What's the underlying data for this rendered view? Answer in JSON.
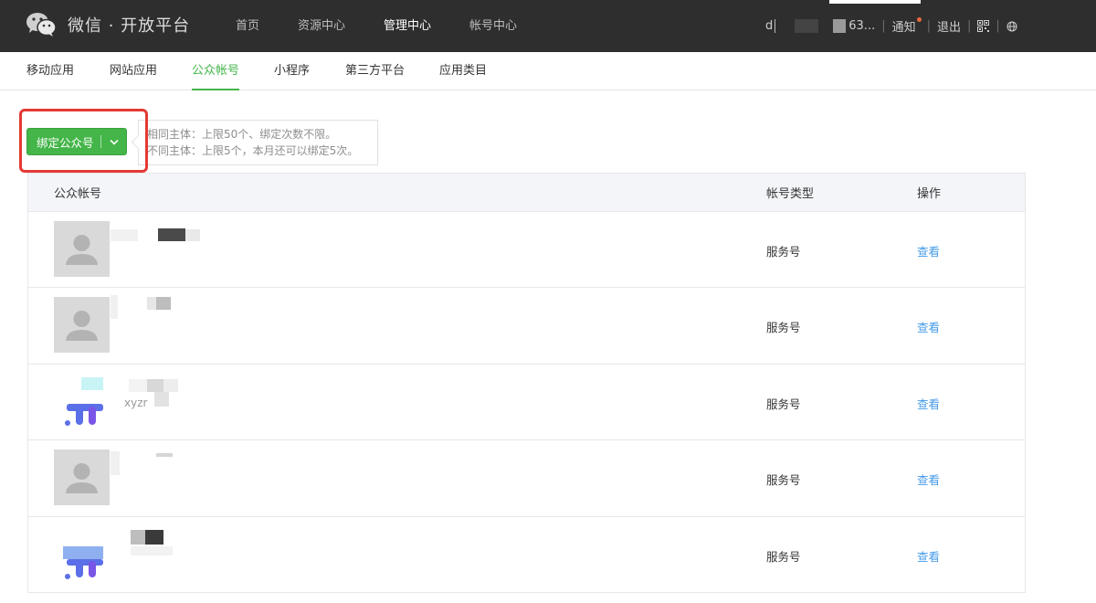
{
  "brand": {
    "name": "微信 · 开放平台"
  },
  "top_nav": [
    {
      "label": "首页",
      "active": false
    },
    {
      "label": "资源中心",
      "active": false
    },
    {
      "label": "管理中心",
      "active": true
    },
    {
      "label": "帐号中心",
      "active": false
    }
  ],
  "user": {
    "name_prefix": "d",
    "name_suffix": "63...",
    "notice_label": "通知",
    "logout_label": "退出",
    "qr_icon": "qrcode-icon",
    "globe_icon": "globe-icon"
  },
  "sub_tabs": [
    {
      "label": "移动应用",
      "active": false
    },
    {
      "label": "网站应用",
      "active": false
    },
    {
      "label": "公众帐号",
      "active": true
    },
    {
      "label": "小程序",
      "active": false
    },
    {
      "label": "第三方平台",
      "active": false
    },
    {
      "label": "应用类目",
      "active": false
    }
  ],
  "bind": {
    "button_label": "绑定公众号",
    "tip_line1": "相同主体：上限50个、绑定次数不限。",
    "tip_line2": "不同主体：上限5个，本月还可以绑定5次。"
  },
  "table": {
    "headers": {
      "account": "公众帐号",
      "type": "帐号类型",
      "op": "操作"
    },
    "rows": [
      {
        "avatar": "default-avatar",
        "sub": "",
        "type": "服务号",
        "op": "查看"
      },
      {
        "avatar": "default-avatar",
        "sub": "",
        "type": "服务号",
        "op": "查看"
      },
      {
        "avatar": "logo-avatar",
        "sub": "xyzr",
        "type": "服务号",
        "op": "查看"
      },
      {
        "avatar": "default-avatar",
        "sub": "",
        "type": "服务号",
        "op": "查看"
      },
      {
        "avatar": "logo-avatar",
        "sub": "",
        "type": "服务号",
        "op": "查看"
      }
    ]
  },
  "colors": {
    "accent_green": "#44b549",
    "link_blue": "#459ae9",
    "highlight_red": "#e53935",
    "topbar_bg": "#2e2e2e"
  }
}
